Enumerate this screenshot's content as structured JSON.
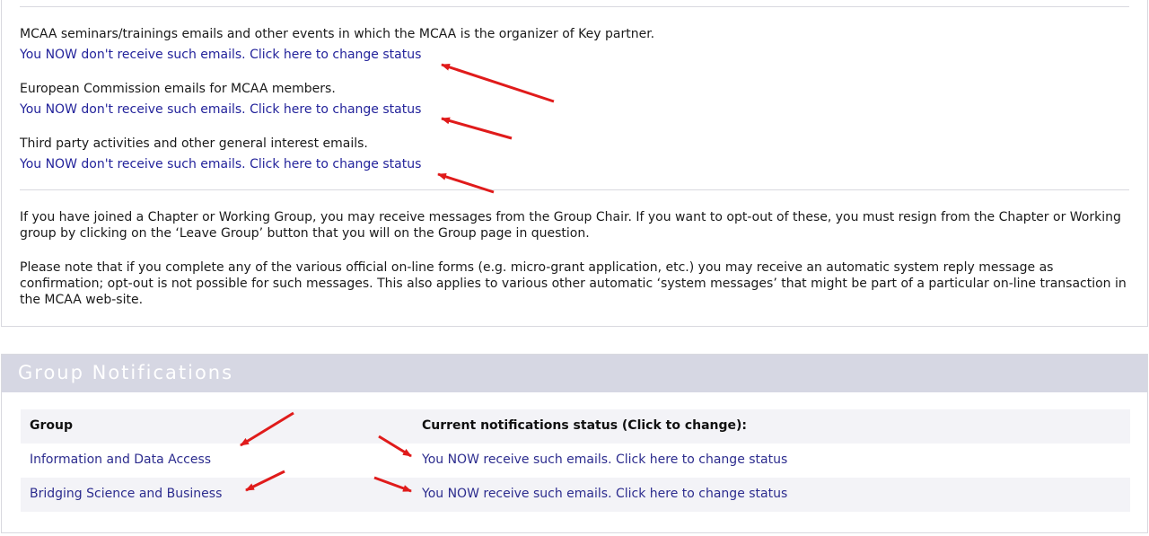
{
  "email_preferences": [
    {
      "title": "MCAA seminars/trainings emails and other events in which the MCAA is the organizer of Key partner.",
      "status_link": "You NOW don't receive such emails. Click here to change status"
    },
    {
      "title": "European Commission emails for MCAA members.",
      "status_link": "You NOW don't receive such emails. Click here to change status"
    },
    {
      "title": "Third party activities and other general interest emails.",
      "status_link": "You NOW don't receive such emails. Click here to change status"
    }
  ],
  "info_paragraphs": [
    "If you have joined a Chapter or Working Group, you may receive messages from the Group Chair. If you want to opt-out of these, you must resign from the Chapter or Working group by clicking on the ‘Leave Group’ button that you will on the Group page in question.",
    "Please note that if you complete any of the various official on-line forms (e.g. micro-grant application, etc.) you may receive an automatic system reply message as confirmation; opt-out is not possible for such messages. This also applies to various other automatic ‘system messages’ that might be part of a particular on-line transaction in the MCAA web-site."
  ],
  "group_notifications": {
    "title": "Group Notifications",
    "columns": [
      "Group",
      "Current notifications status (Click to change):"
    ],
    "rows": [
      {
        "group": "Information and Data Access",
        "status": "You NOW receive such emails. Click here to change status"
      },
      {
        "group": "Bridging Science and Business",
        "status": "You NOW receive such emails. Click here to change status"
      }
    ]
  },
  "colors": {
    "link": "#23239b",
    "header_band": "#d6d7e3",
    "annotation_arrow": "#e01b1b"
  },
  "icons": [
    "red-annotation-arrow"
  ]
}
